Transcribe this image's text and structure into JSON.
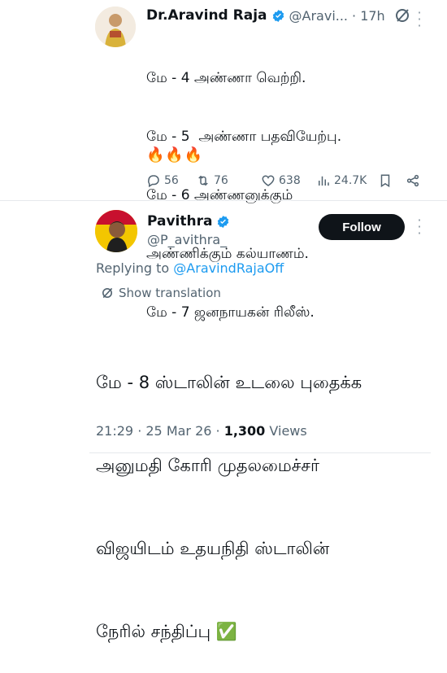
{
  "tweet1": {
    "author_name": "Dr.Aravind Raja",
    "handle": "@Aravi...",
    "time": "· 17h",
    "lines": [
      "மே - 4 அண்ணா வெற்றி.",
      "மே - 5  அண்ணா பதவியேற்பு.",
      "மே - 6 அண்ணனுக்கும்",
      "அண்ணிக்கும் கல்யாணம்.",
      "மே - 7 ஜனநாயகன் ரிலீஸ்."
    ],
    "emoji": "🔥🔥🔥",
    "replies": "56",
    "reposts": "76",
    "likes": "638",
    "views": "24.7K"
  },
  "tweet2": {
    "author_name": "Pavithra",
    "handle": "@P_avithra_",
    "follow_label": "Follow",
    "replying_prefix": "Replying to ",
    "replying_to": "@AravindRajaOff",
    "translate_label": "Show translation",
    "lines": [
      "மே - 8 ஸ்டாலின் உடலை புதைக்க",
      "அனுமதி கோரி முதலமைச்சர்",
      "விஜயிடம் உதயநிதி ஸ்டாலின்",
      "நேரில் சந்திப்பு ✅"
    ],
    "timestamp": "21:29 · 25 Mar 26 · ",
    "views_count": "1,300",
    "views_label": " Views"
  },
  "colors": {
    "accent": "#1d9bf0",
    "text": "#0f1419",
    "muted": "#536471",
    "button": "#0f1419"
  }
}
